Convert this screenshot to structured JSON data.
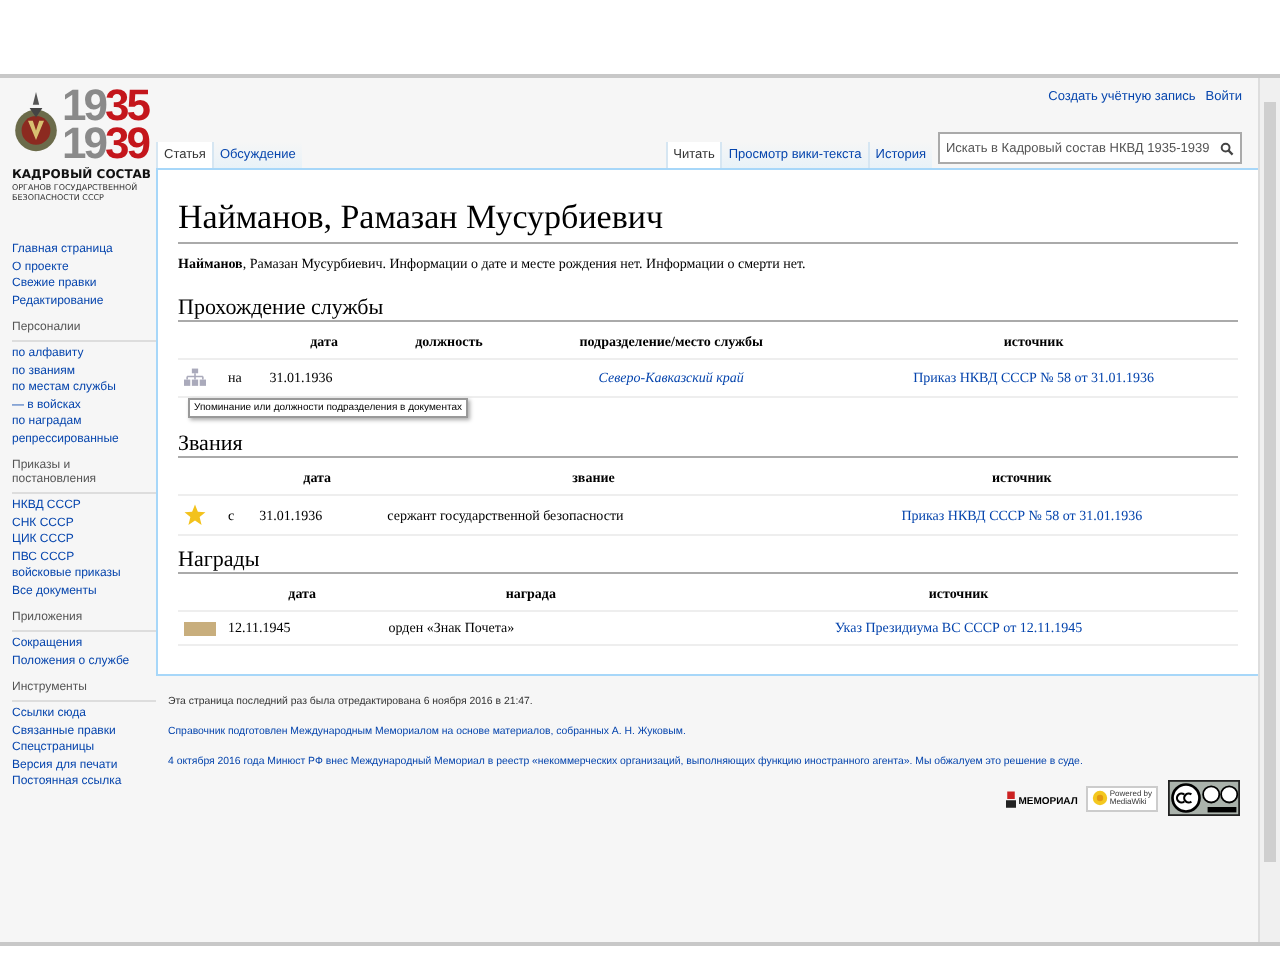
{
  "logo": {
    "years": [
      {
        "century": "19",
        "year": "35"
      },
      {
        "century": "19",
        "year": "39"
      }
    ],
    "title": "КАДРОВЫЙ СОСТАВ",
    "subtitle": [
      "ОРГАНОВ ГОСУДАРСТВЕННОЙ",
      "БЕЗОПАСНОСТИ СССР"
    ]
  },
  "personal_tools": [
    "Создать учётную запись",
    "Войти"
  ],
  "left_tabs": [
    {
      "label": "Статья",
      "selected": true
    },
    {
      "label": "Обсуждение",
      "selected": false
    }
  ],
  "right_tabs": [
    {
      "label": "Читать",
      "selected": true
    },
    {
      "label": "Просмотр вики-текста",
      "selected": false
    },
    {
      "label": "История",
      "selected": false
    }
  ],
  "search": {
    "placeholder": "Искать в Кадровый состав НКВД 1935-1939"
  },
  "sidebar": [
    {
      "items": [
        "Главная страница",
        "О проекте",
        "Свежие правки",
        "Редактирование"
      ]
    },
    {
      "heading": "Персоналии",
      "items": [
        "по алфавиту",
        "по званиям",
        "по местам службы",
        "— в войсках",
        "по наградам",
        "репрессированные"
      ]
    },
    {
      "heading": "Приказы и постановления",
      "items": [
        "НКВД СССР",
        "СНК СССР",
        "ЦИК СССР",
        "ПВС СССР",
        "войсковые приказы",
        "Все документы"
      ]
    },
    {
      "heading": "Приложения",
      "items": [
        "Сокращения",
        "Положения о службе"
      ]
    },
    {
      "heading": "Инструменты",
      "items": [
        "Ссылки сюда",
        "Связанные правки",
        "Спецстраницы",
        "Версия для печати",
        "Постоянная ссылка"
      ]
    }
  ],
  "title": "Найманов, Рамазан Мусурбиевич",
  "intro": "**Найманов**, Рамазан Мусурбиевич. Информации о дате и месте рождения нет. Информации о смерти нет.",
  "service": {
    "heading": "Прохождение службы",
    "columns": [
      "дата",
      "должность",
      "подразделение/место службы",
      "источник"
    ],
    "rows": [
      {
        "prefix": "на",
        "date": "31.01.1936",
        "unit": "Северо-Кавказский край",
        "source": "Приказ НКВД СССР № 58 от 31.01.1936"
      }
    ],
    "tooltip": "Упоминание или должности подразделения в документах"
  },
  "ranks": {
    "heading": "Звания",
    "columns": [
      "дата",
      "звание",
      "источник"
    ],
    "rows": [
      {
        "prefix": "с",
        "date": "31.01.1936",
        "rank": "сержант государственной безопасности",
        "source": "Приказ НКВД СССР № 58 от 31.01.1936"
      }
    ]
  },
  "awards": {
    "heading": "Награды",
    "columns": [
      "дата",
      "награда",
      "источник"
    ],
    "rows": [
      {
        "color": "#c8ae7d",
        "date": "12.11.1945",
        "award": "орден «Знак Почета»",
        "source": "Указ Президиума ВС СССР от 12.11.1945"
      }
    ]
  },
  "footer": {
    "last_edited": "Эта страница последний раз была отредактирована 6 ноября 2016 в 21:47.",
    "credits": "Справочник подготовлен Международным Мемориалом на основе материалов, собранных А. Н. Жуковым.",
    "notice": "4 октября 2016 года Минюст РФ внес Международный Мемориал в реестр «некоммерческих организаций, выполняющих функцию иностранного агента». Мы обжалуем это решение в суде.",
    "memorial": "МЕМОРИАЛ",
    "powered": "Powered by",
    "mediawiki": "MediaWiki"
  }
}
